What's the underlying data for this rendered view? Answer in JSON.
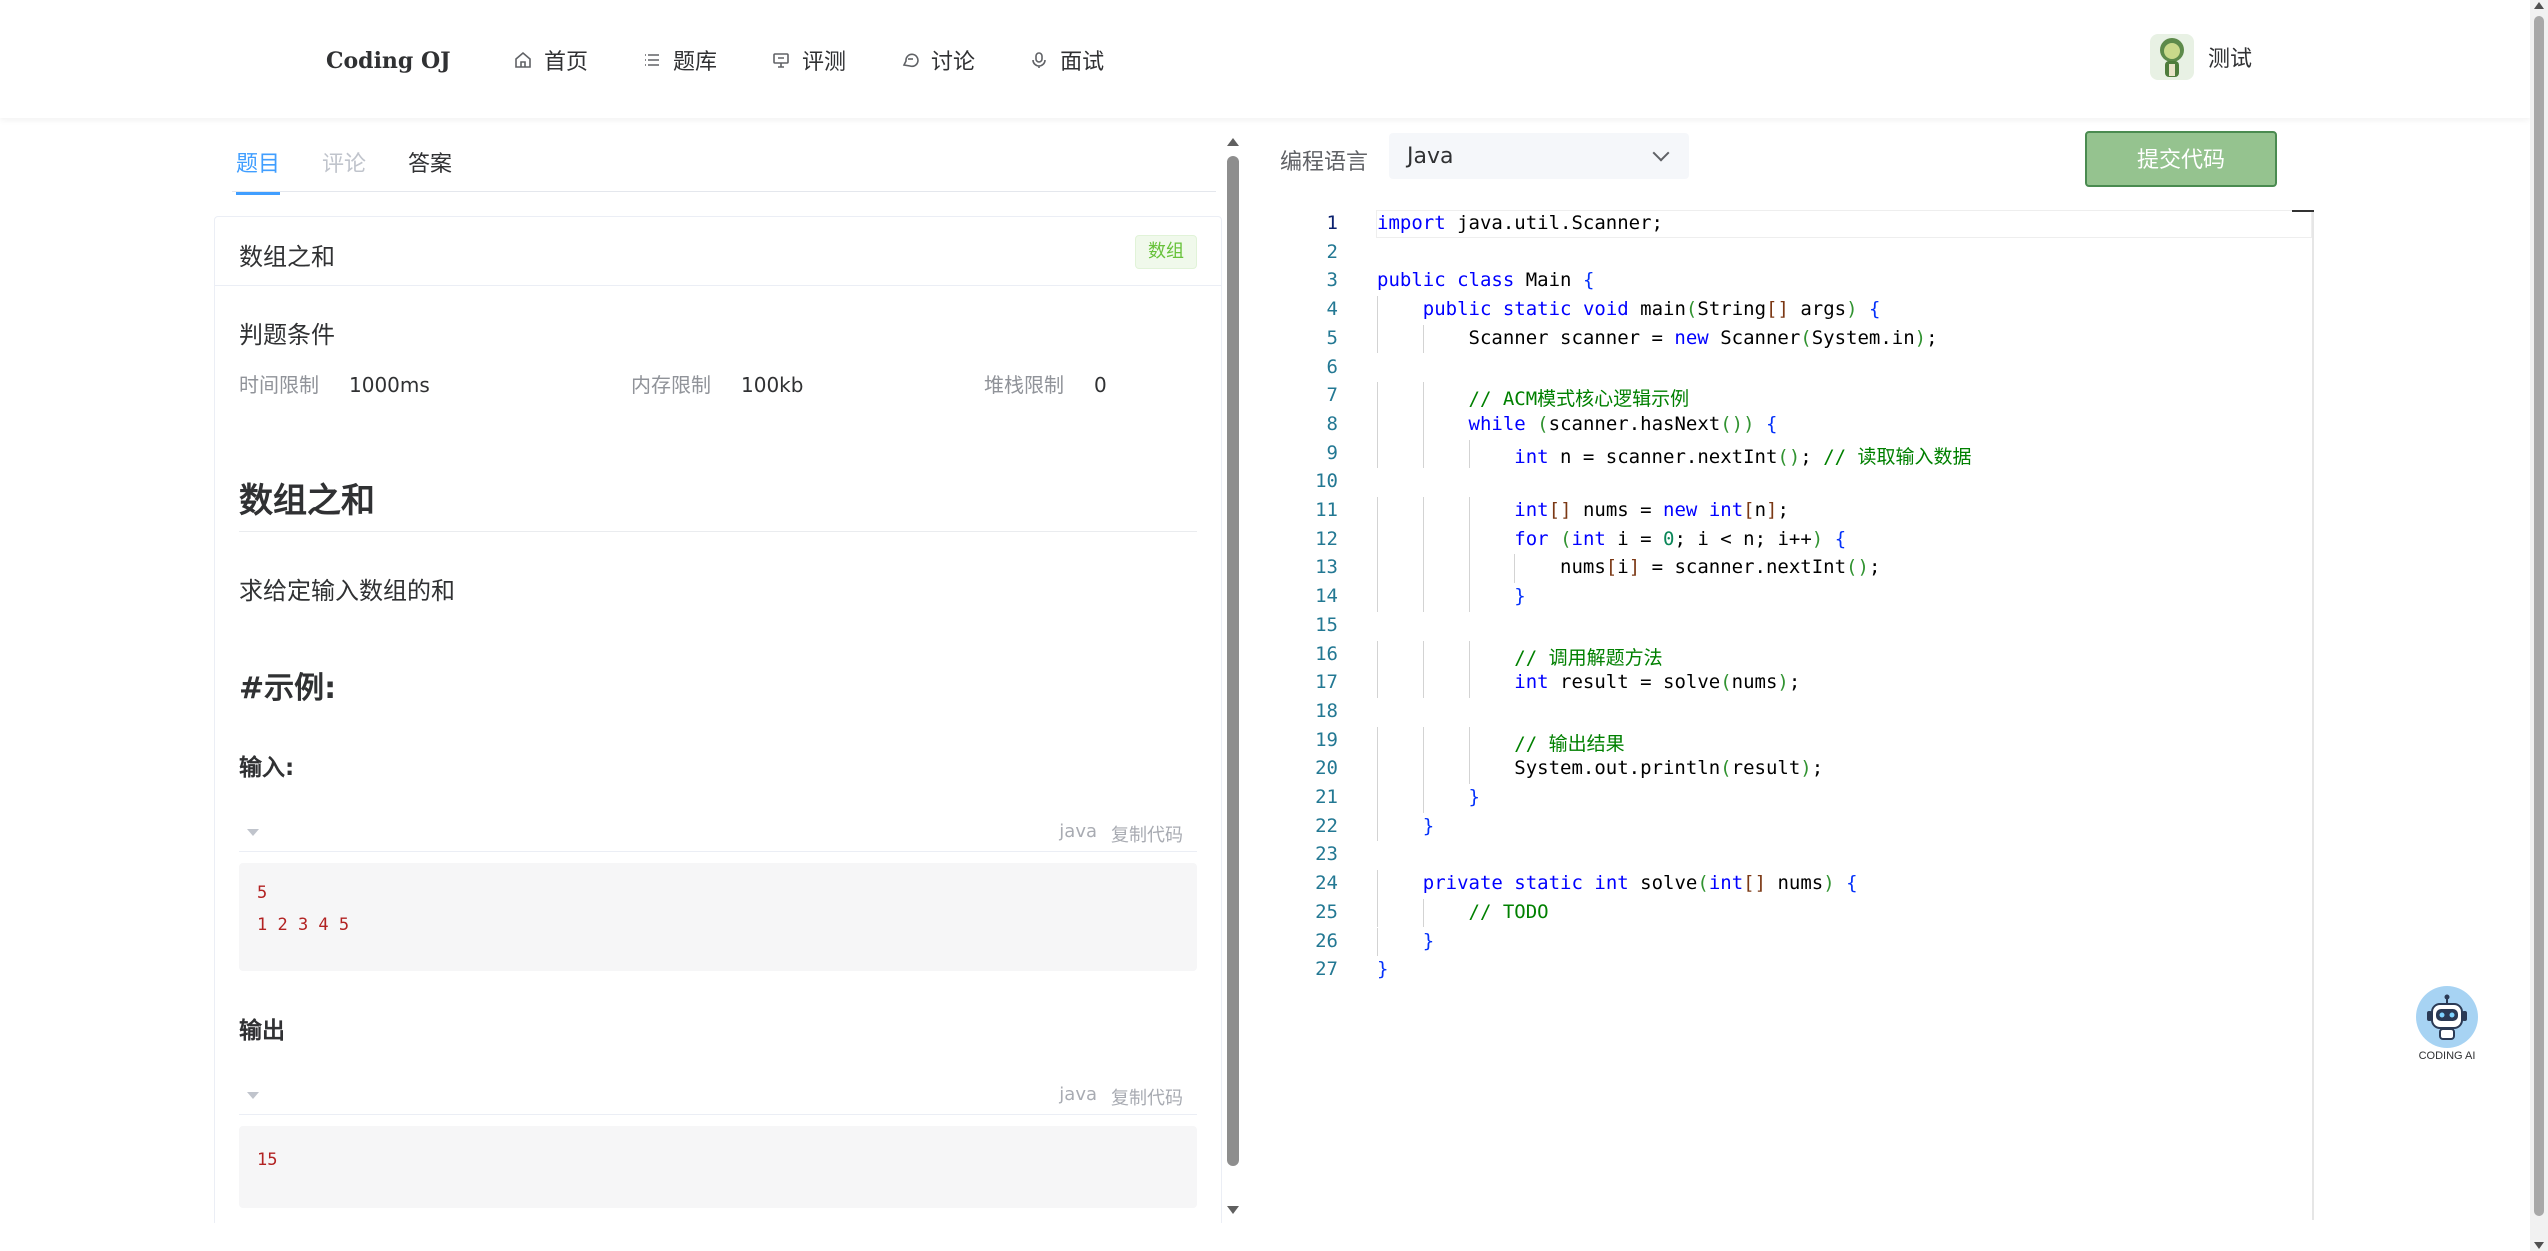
{
  "header": {
    "logo": "Coding OJ",
    "nav": [
      {
        "label": "首页",
        "icon": "home-icon"
      },
      {
        "label": "题库",
        "icon": "list-icon"
      },
      {
        "label": "评测",
        "icon": "monitor-icon"
      },
      {
        "label": "讨论",
        "icon": "chat-icon"
      },
      {
        "label": "面试",
        "icon": "microphone-icon"
      }
    ],
    "user_name": "测试"
  },
  "tabs": [
    {
      "label": "题目",
      "state": "active"
    },
    {
      "label": "评论",
      "state": "disabled"
    },
    {
      "label": "答案",
      "state": "normal"
    }
  ],
  "problem": {
    "title": "数组之和",
    "tag": "数组",
    "conditions_title": "判题条件",
    "limits": [
      {
        "label": "时间限制",
        "value": "1000ms"
      },
      {
        "label": "内存限制",
        "value": "100kb"
      },
      {
        "label": "堆栈限制",
        "value": "0"
      }
    ],
    "heading": "数组之和",
    "description": "求给定输入数组的和",
    "example_heading": "#示例:",
    "input_heading": "输入:",
    "input_lang": "java",
    "input_lines": [
      "5",
      "1 2 3 4 5"
    ],
    "output_heading": "输出",
    "output_lang": "java",
    "output_lines": [
      "15"
    ],
    "copy_label": "复制代码"
  },
  "editor_bar": {
    "lang_label": "编程语言",
    "selected_lang": "Java",
    "submit_label": "提交代码"
  },
  "code_lines": [
    "import java.util.Scanner;",
    "",
    "public class Main {",
    "    public static void main(String[] args) {",
    "        Scanner scanner = new Scanner(System.in);",
    "",
    "        // ACM模式核心逻辑示例",
    "        while (scanner.hasNext()) {",
    "            int n = scanner.nextInt(); // 读取输入数据",
    "",
    "            int[] nums = new int[n];",
    "            for (int i = 0; i < n; i++) {",
    "                nums[i] = scanner.nextInt();",
    "            }",
    "",
    "            // 调用解题方法",
    "            int result = solve(nums);",
    "",
    "            // 输出结果",
    "            System.out.println(result);",
    "        }",
    "    }",
    "",
    "    private static int solve(int[] nums) {",
    "        // TODO",
    "    }",
    "}"
  ],
  "ai_button": {
    "label": "CODING AI",
    "icon": "robot-icon"
  }
}
